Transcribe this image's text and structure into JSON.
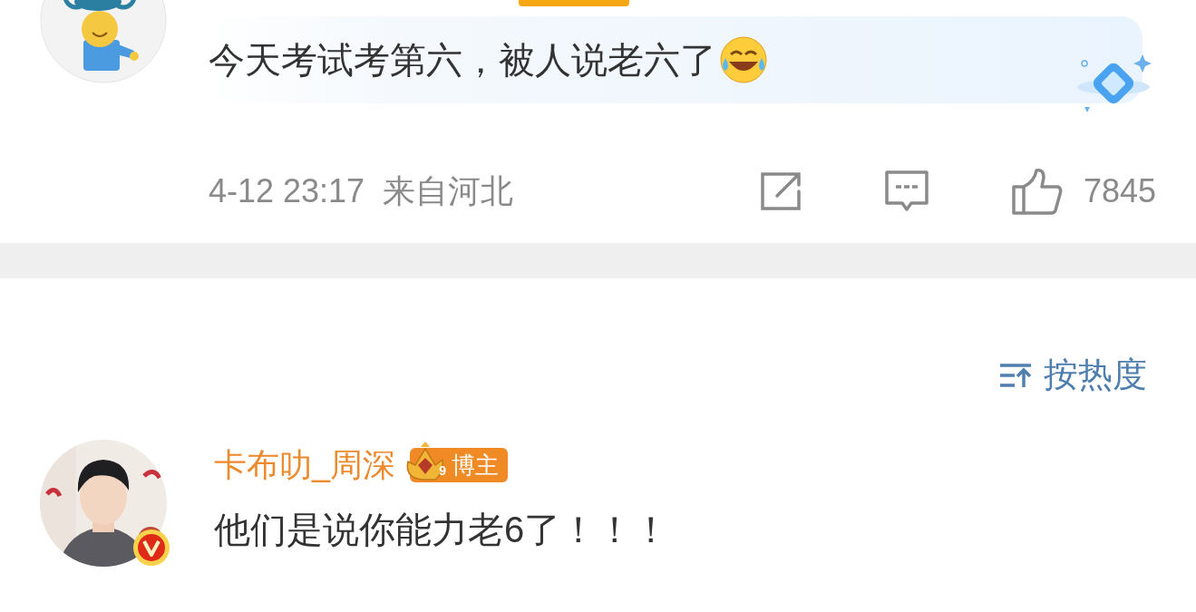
{
  "top_comment": {
    "text": "今天考试考第六，被人说老六了",
    "highlighted": true,
    "time": "4-12 23:17",
    "location": "来自河北",
    "like_count": "7845"
  },
  "sort": {
    "label": "按热度"
  },
  "reply": {
    "author": "卡布叻_周深",
    "level": "9",
    "role": "博主",
    "verified": true,
    "text": "他们是说你能力老6了！！！"
  }
}
